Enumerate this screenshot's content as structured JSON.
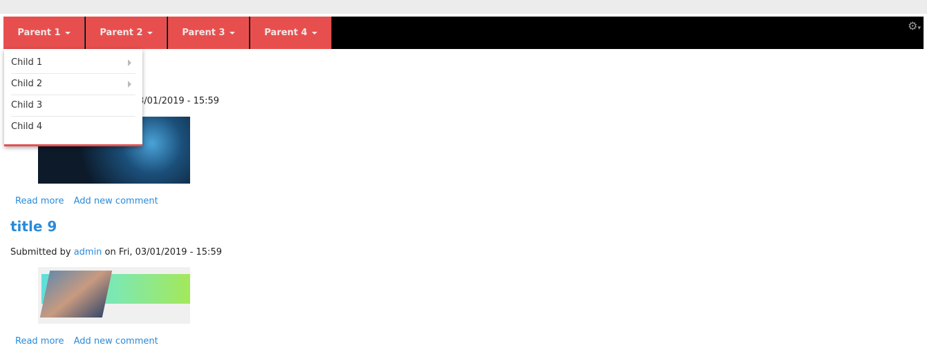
{
  "nav": {
    "items": [
      "Parent 1",
      "Parent 2",
      "Parent 3",
      "Parent 4"
    ],
    "accent": "#e74f4e",
    "settings_icon": "gear-icon"
  },
  "dropdown": {
    "items": [
      {
        "label": "Child 1",
        "submenu": true
      },
      {
        "label": "Child 2",
        "submenu": true
      },
      {
        "label": "Child 3",
        "submenu": false
      },
      {
        "label": "Child 4",
        "submenu": false
      }
    ]
  },
  "posts": [
    {
      "submitted_visible": "3/01/2019 - 15:59",
      "read_more": "Read more",
      "add_comment": "Add new comment"
    },
    {
      "title": "title 9",
      "submitted_prefix": "Submitted by ",
      "author": "admin",
      "submitted_suffix": " on Fri, 03/01/2019 - 15:59",
      "read_more": "Read more",
      "add_comment": "Add new comment"
    }
  ]
}
